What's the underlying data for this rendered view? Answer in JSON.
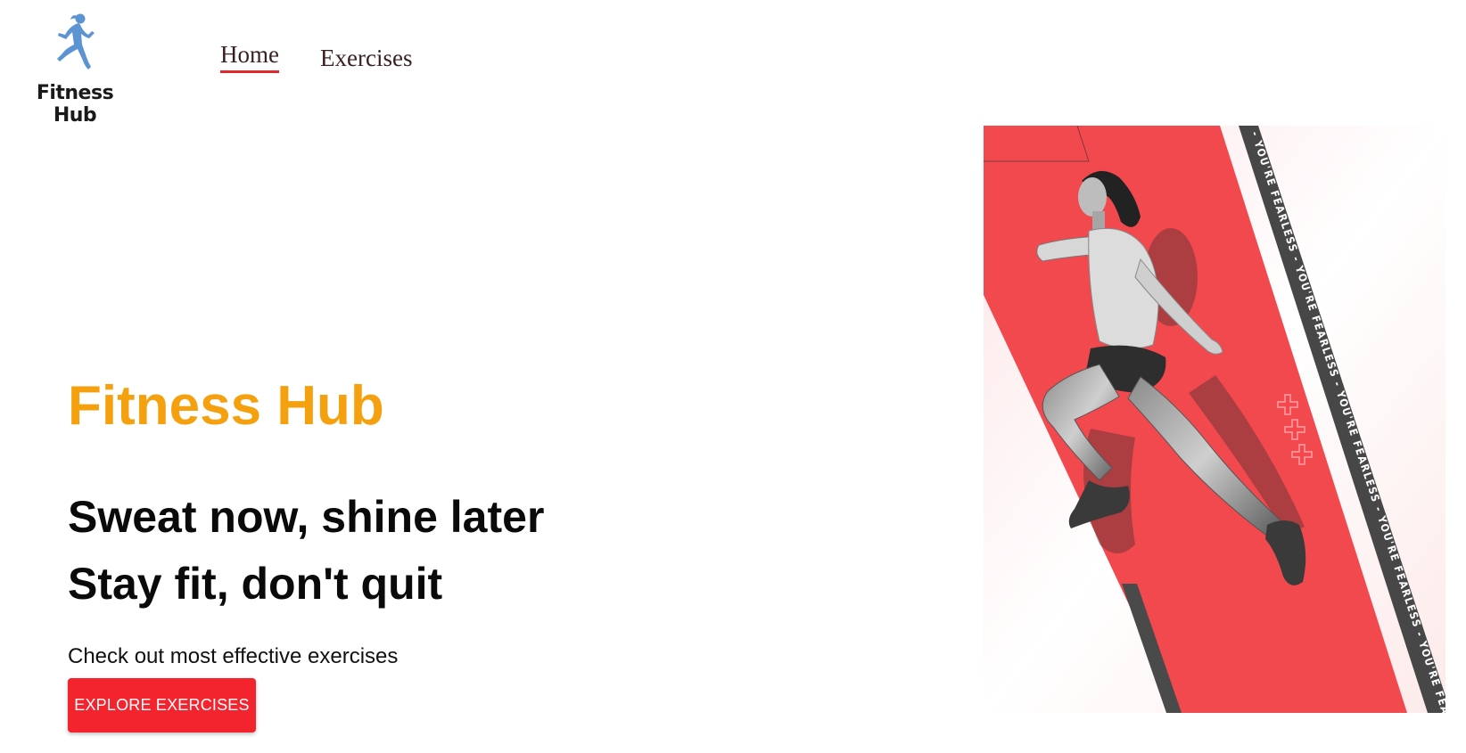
{
  "brand": {
    "logo_text": "Fitness Hub",
    "logo_icon": "running-woman-icon",
    "logo_color": "#5b93d3"
  },
  "nav": {
    "items": [
      {
        "label": "Home",
        "active": true
      },
      {
        "label": "Exercises",
        "active": false
      }
    ]
  },
  "hero": {
    "title": "Fitness Hub",
    "tagline_1": "Sweat now, shine later",
    "tagline_2": "Stay fit, don't quit",
    "subtext": "Check out most effective exercises",
    "cta_label": "EXPLORE EXERCISES"
  },
  "banner": {
    "stripe_text": "- YOU'RE FEARLESS - YOU'RE FEARLESS - YOU'RE FEARLESS - YOU'RE FEARLESS - YOU'RE FEARLESS",
    "image_subject": "jumping-athlete"
  },
  "colors": {
    "accent": "#f4242f",
    "title": "#f5a10f",
    "banner_red": "#f2494f",
    "stripe_dark": "#4a4a4a"
  }
}
